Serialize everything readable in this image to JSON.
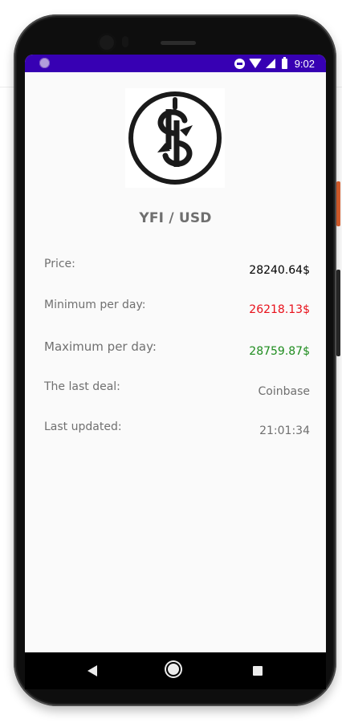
{
  "status_bar": {
    "time": "9:02",
    "icons": [
      "notification-dot-icon",
      "do-not-disturb-icon",
      "wifi-icon",
      "cell-signal-icon",
      "battery-icon"
    ],
    "color": "#3700b3"
  },
  "logo": {
    "icon": "yearn-finance-logo"
  },
  "pair_title": "YFI / USD",
  "rows": [
    {
      "label": "Price:",
      "value": "28240.64$",
      "value_color": "#000000"
    },
    {
      "label": "Minimum per day:",
      "value": "26218.13$",
      "value_color": "#e8101a"
    },
    {
      "label": "Maximum per day:",
      "value": "28759.87$",
      "value_color": "#1e8c1e"
    },
    {
      "label": "The last deal:",
      "value": "Coinbase",
      "value_color": "#6f6f6f"
    },
    {
      "label": "Last updated:",
      "value": "21:01:34",
      "value_color": "#6f6f6f"
    }
  ],
  "nav_bar": {
    "icons": [
      "back-icon",
      "home-icon",
      "recents-icon"
    ]
  }
}
